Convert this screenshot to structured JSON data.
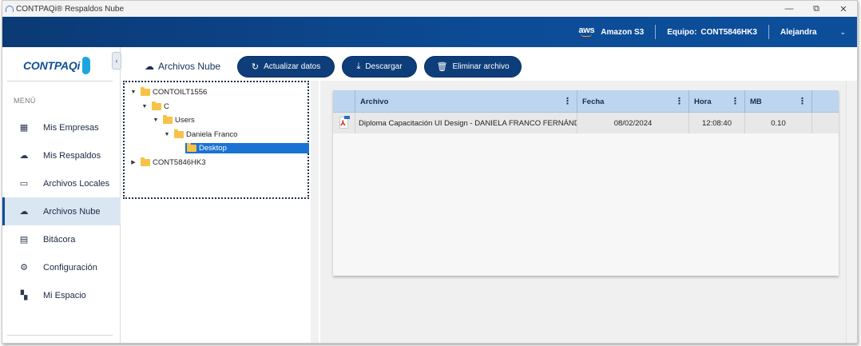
{
  "window": {
    "title": "CONTPAQi® Respaldos Nube",
    "controls": {
      "minimize": "—",
      "restore": "⧉",
      "close": "✕"
    }
  },
  "header": {
    "aws_logo": "aws",
    "storage": "Amazon S3",
    "equipo_label": "Equipo:",
    "equipo_value": "CONT5846HK3",
    "user": "Alejandra",
    "user_chevron": "⌄"
  },
  "sidebar": {
    "logo_text": "CONTPAQi",
    "collapse_icon": "‹",
    "menu_label": "MENÚ",
    "items": [
      {
        "label": "Mis Empresas",
        "icon": "building-icon",
        "glyph": "▦"
      },
      {
        "label": "Mis Respaldos",
        "icon": "cloud-icon",
        "glyph": "☁"
      },
      {
        "label": "Archivos Locales",
        "icon": "folder-icon",
        "glyph": "▭"
      },
      {
        "label": "Archivos Nube",
        "icon": "cloud-upload-icon",
        "glyph": "☁"
      },
      {
        "label": "Bitácora",
        "icon": "clipboard-icon",
        "glyph": "▤"
      },
      {
        "label": "Configuración",
        "icon": "gear-icon",
        "glyph": "⚙"
      },
      {
        "label": "Mi Espacio",
        "icon": "dashboard-icon",
        "glyph": "▚"
      }
    ],
    "active_index": 3
  },
  "toolbar": {
    "title": "Archivos Nube",
    "title_glyph": "☁",
    "refresh_label": "Actualizar datos",
    "refresh_glyph": "↻",
    "download_label": "Descargar",
    "download_glyph": "⤓",
    "delete_label": "Eliminar archivo",
    "delete_glyph": "🗑"
  },
  "tree": {
    "nodes": [
      {
        "label": "CONTOILT1556",
        "toggle": "▼",
        "level": 0
      },
      {
        "label": "C",
        "toggle": "▼",
        "level": 1
      },
      {
        "label": "Users",
        "toggle": "▼",
        "level": 2
      },
      {
        "label": "Daniela Franco",
        "toggle": "▼",
        "level": 3
      },
      {
        "label": "Desktop",
        "toggle": "",
        "level": 4,
        "selected": true
      },
      {
        "label": "CONT5846HK3",
        "toggle": "▶",
        "level": 0
      }
    ]
  },
  "grid": {
    "columns": [
      "Archivo",
      "Fecha",
      "Hora",
      "MB"
    ],
    "column_menu_glyph": "⋮",
    "rows": [
      {
        "archivo": "Diploma Capacitación UI Design - DANIELA FRANCO FERNÁNDEZ",
        "fecha": "08/02/2024",
        "hora": "12:08:40",
        "mb": "0.10"
      }
    ]
  },
  "colors": {
    "header_blue": "#0c4c97",
    "button_blue": "#0d3e7a",
    "selected_tree": "#1a73d1",
    "grid_header": "#bdd5ee",
    "active_nav": "#dbe6f3"
  }
}
